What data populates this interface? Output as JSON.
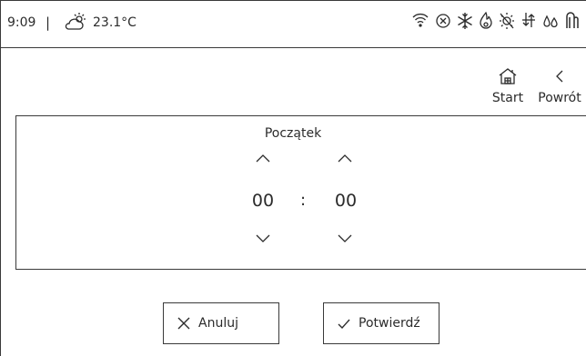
{
  "status": {
    "time": "9:09",
    "separator": "|",
    "temperature": "23.1°C",
    "icons": [
      "wifi-icon",
      "cancel-circle-icon",
      "snowflake-icon",
      "flame-icon",
      "sun-off-icon",
      "circulation-arrows-icon",
      "water-drops-icon",
      "heating-pipe-icon"
    ]
  },
  "nav": {
    "start_label": "Start",
    "back_label": "Powrót"
  },
  "picker": {
    "title": "Początek",
    "hours": "00",
    "colon": ":",
    "minutes": "00"
  },
  "actions": {
    "cancel_label": "Anuluj",
    "confirm_label": "Potwierdź"
  }
}
